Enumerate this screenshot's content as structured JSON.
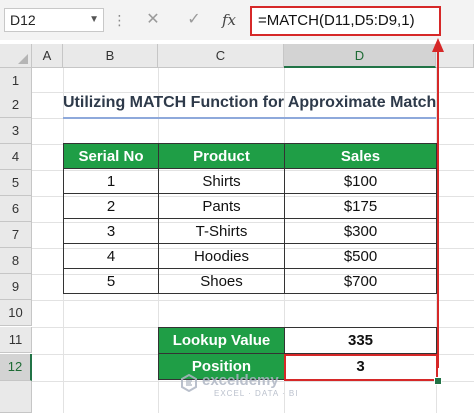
{
  "formula_bar": {
    "name_box": "D12",
    "cancel_glyph": "✕",
    "enter_glyph": "✓",
    "fx_label": "fx",
    "formula": "=MATCH(D11,D5:D9,1)"
  },
  "columns": [
    "A",
    "B",
    "C",
    "D"
  ],
  "rows": [
    "1",
    "2",
    "3",
    "4",
    "5",
    "6",
    "7",
    "8",
    "9",
    "10",
    "11",
    "12"
  ],
  "selected_cell": "D12",
  "title": "Utilizing MATCH Function for Approximate Match",
  "table": {
    "headers": [
      "Serial No",
      "Product",
      "Sales"
    ],
    "rows": [
      [
        "1",
        "Shirts",
        "$100"
      ],
      [
        "2",
        "Pants",
        "$175"
      ],
      [
        "3",
        "T-Shirts",
        "$300"
      ],
      [
        "4",
        "Hoodies",
        "$500"
      ],
      [
        "5",
        "Shoes",
        "$700"
      ]
    ]
  },
  "lookup": {
    "lookup_label": "Lookup Value",
    "lookup_value": "335",
    "position_label": "Position",
    "position_value": "3"
  },
  "watermark": {
    "name": "exceldemy",
    "tagline": "EXCEL · DATA · BI"
  },
  "colors": {
    "header_green": "#1f9e46",
    "highlight_red": "#d62828",
    "excel_green": "#217346"
  },
  "icons": [
    "chevron-down-icon",
    "cancel-icon",
    "enter-icon",
    "fx-icon",
    "select-all-icon",
    "exceldemy-logo-icon"
  ]
}
